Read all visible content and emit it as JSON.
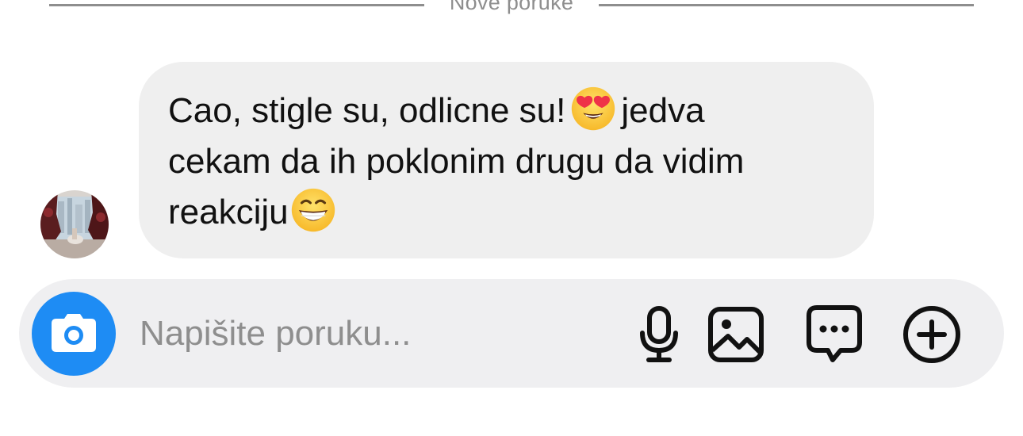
{
  "divider": {
    "label": "Nove poruke"
  },
  "message": {
    "line1_text": "Cao, stigle su, odlicne su!",
    "line1_emoji": "smiling-face-with-heart-eyes",
    "line1_after": "jedva",
    "line2": "cekam da ih poklonim drugu da vidim",
    "line3_text": "reakciju",
    "line3_emoji": "grinning-face-with-smiling-eyes"
  },
  "composer": {
    "placeholder": "Napišite poruku...",
    "icons": [
      "camera-icon",
      "microphone-icon",
      "gallery-icon",
      "sticker-message-icon",
      "add-icon"
    ]
  },
  "colors": {
    "accent": "#1e8cf4",
    "bubble": "#efefef",
    "composer": "#efeff1",
    "muted_text": "#8e8e8e"
  }
}
